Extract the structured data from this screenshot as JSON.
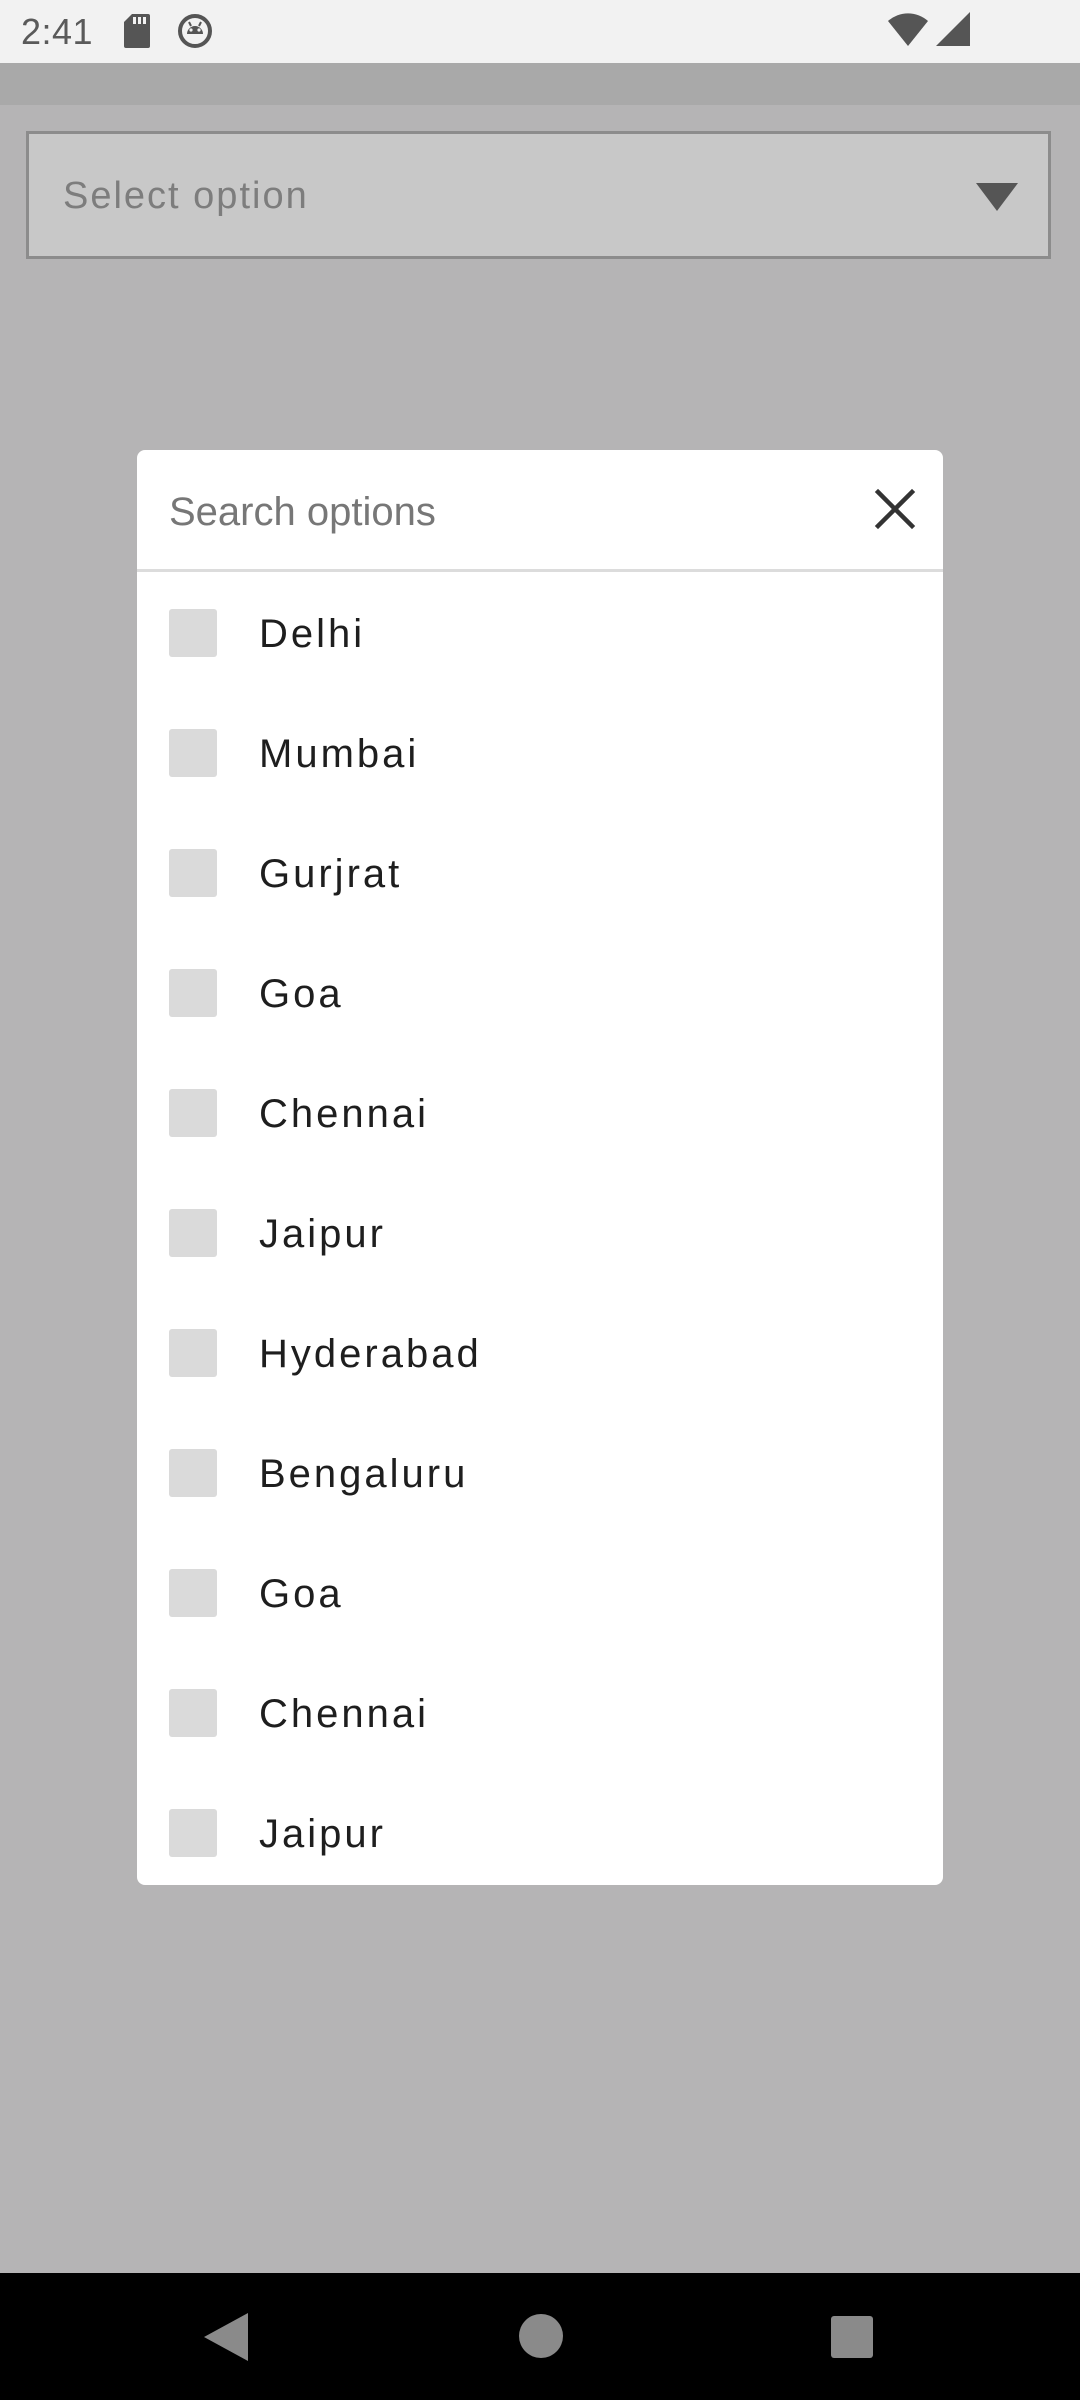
{
  "status_bar": {
    "time": "2:41",
    "icons": [
      "sd-card-icon",
      "android-debug-icon",
      "wifi-icon",
      "signal-icon"
    ]
  },
  "select": {
    "placeholder": "Select option",
    "arrow_icon": "dropdown-arrow-icon"
  },
  "dialog": {
    "search_placeholder": "Search options",
    "close_icon": "close-icon",
    "options": [
      {
        "label": "Delhi",
        "checked": false
      },
      {
        "label": "Mumbai",
        "checked": false
      },
      {
        "label": "Gurjrat",
        "checked": false
      },
      {
        "label": "Goa",
        "checked": false
      },
      {
        "label": "Chennai",
        "checked": false
      },
      {
        "label": "Jaipur",
        "checked": false
      },
      {
        "label": "Hyderabad",
        "checked": false
      },
      {
        "label": "Bengaluru",
        "checked": false
      },
      {
        "label": "Goa",
        "checked": false
      },
      {
        "label": "Chennai",
        "checked": false
      },
      {
        "label": "Jaipur",
        "checked": false
      }
    ]
  },
  "nav_bar": {
    "icons": [
      "back-icon",
      "home-icon",
      "recents-icon"
    ]
  },
  "colors": {
    "scrim": "#b5b4b5",
    "dialog_bg": "#ffffff",
    "checkbox": "#dadada",
    "nav_bar": "#000000"
  }
}
